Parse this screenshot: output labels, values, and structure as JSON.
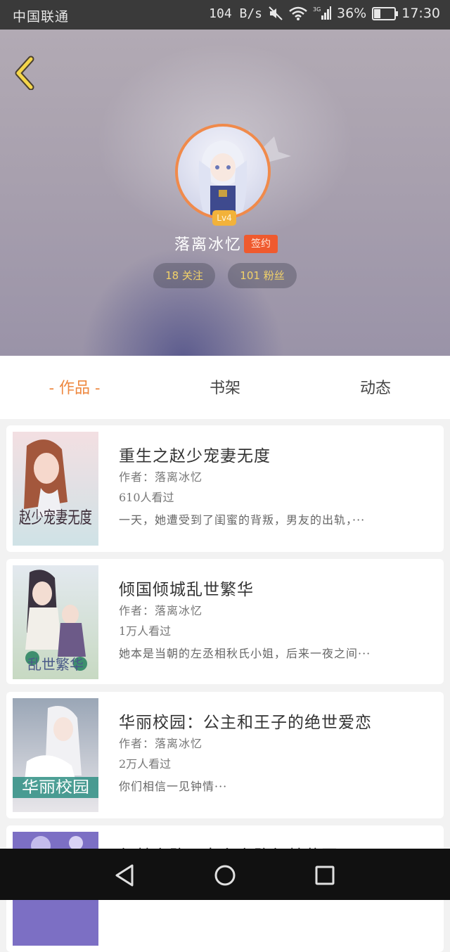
{
  "status_bar": {
    "carrier": "中国联通",
    "speed": "104 B/s",
    "signal_type": "3G",
    "battery": "36%",
    "time": "17:30"
  },
  "profile": {
    "username": "落离冰忆",
    "level": "Lv4",
    "sign_badge": "签约",
    "following": "18 关注",
    "fans": "101 粉丝"
  },
  "tabs": [
    {
      "label": "- 作品 -",
      "active": true
    },
    {
      "label": "书架",
      "active": false
    },
    {
      "label": "动态",
      "active": false
    }
  ],
  "books": [
    {
      "title": "重生之赵少宠妻无度",
      "author": "作者：落离冰忆",
      "views": "610人看过",
      "desc": "一天，她遭受到了闺蜜的背叛，男友的出轨，···",
      "cover_text": "赵少宠妻无度"
    },
    {
      "title": "倾国倾城乱世繁华",
      "author": "作者：落离冰忆",
      "views": "1万人看过",
      "desc": "她本是当朝的左丞相秋氏小姐，后来一夜之间···",
      "cover_text": "乱世繁华"
    },
    {
      "title": "华丽校园：公主和王子的绝世爱恋",
      "author": "作者：落离冰忆",
      "views": "2万人看过",
      "desc": "你们相信一见钟情···",
      "cover_text": "华丽校园"
    },
    {
      "title": "气林之路：女主之路气林花园",
      "author": "",
      "views": "",
      "desc": "",
      "cover_text": ""
    }
  ],
  "colors": {
    "accent": "#ee8840",
    "sign_badge": "#ef5a2e",
    "level_badge": "#f2b23a",
    "pill_text": "#f2d269"
  },
  "icons": {
    "back": "chevron-left-icon",
    "nav_back": "triangle-back-icon",
    "nav_home": "circle-home-icon",
    "nav_recents": "square-recents-icon"
  }
}
